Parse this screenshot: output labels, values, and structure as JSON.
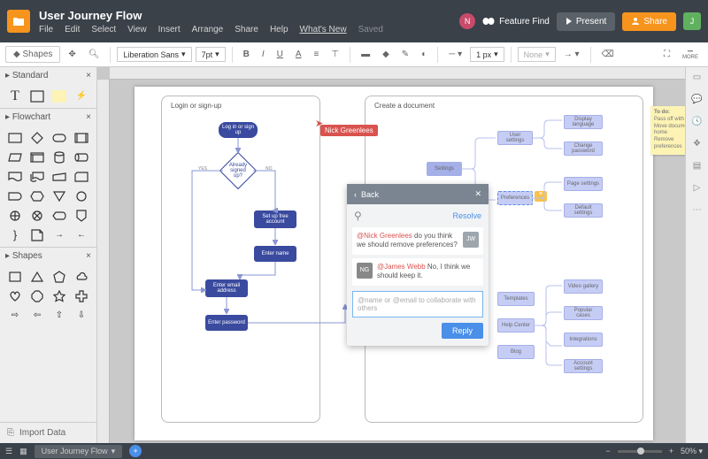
{
  "title": "User Journey Flow",
  "menus": [
    "File",
    "Edit",
    "Select",
    "View",
    "Insert",
    "Arrange",
    "Share",
    "Help",
    "What's New",
    "Saved"
  ],
  "tb": {
    "shapes": "Shapes",
    "font": "Liberation Sans",
    "size": "7pt",
    "lineW": "1 px",
    "none": "None",
    "more": "MORE"
  },
  "buttons": {
    "featureFind": "Feature Find",
    "present": "Present",
    "share": "Share"
  },
  "avatars": {
    "n": "N",
    "j": "J"
  },
  "panels": {
    "standard": "Standard",
    "flowchart": "Flowchart",
    "shapes": "Shapes",
    "import": "Import Data"
  },
  "canvas": {
    "g1": "Login or sign-up",
    "g2": "Create a document",
    "login": {
      "start": "Log in or sign up",
      "dec": "Already signed up?",
      "yes": "YES",
      "no": "NO",
      "setup": "Set up free account",
      "name": "Enter name",
      "email": "Enter email address",
      "pwd": "Enter password"
    },
    "tree": {
      "settings": "Settings",
      "userSettings": "User settings",
      "dispLang": "Display language",
      "changePwd": "Change password",
      "prefs": "Preferences",
      "pageSet": "Page settings",
      "defSet": "Default settings",
      "templates": "Templates",
      "helpCenter": "Help Center",
      "blog": "Blog",
      "videoGal": "Video gallery",
      "popCases": "Popular cases",
      "integ": "Integrations",
      "accSet": "Account settings"
    },
    "cursor": "Nick Greenlees",
    "sticky": {
      "h": "To do:",
      "l1": "Pass off with team",
      "l2": "Move document to home",
      "l3": "Remove preferences"
    }
  },
  "comments": {
    "back": "Back",
    "resolve": "Resolve",
    "reply": "Reply",
    "placeholder": "@name or @email to collaborate with others",
    "m1": {
      "av": "JW",
      "mention": "@Nick Greenlees",
      "text": " do you think we should remove preferences?"
    },
    "m2": {
      "av": "NG",
      "mention": "@James Webb",
      "text": " No, I think we should keep it."
    }
  },
  "bottom": {
    "tab": "User Journey Flow",
    "zoom": "50%"
  }
}
